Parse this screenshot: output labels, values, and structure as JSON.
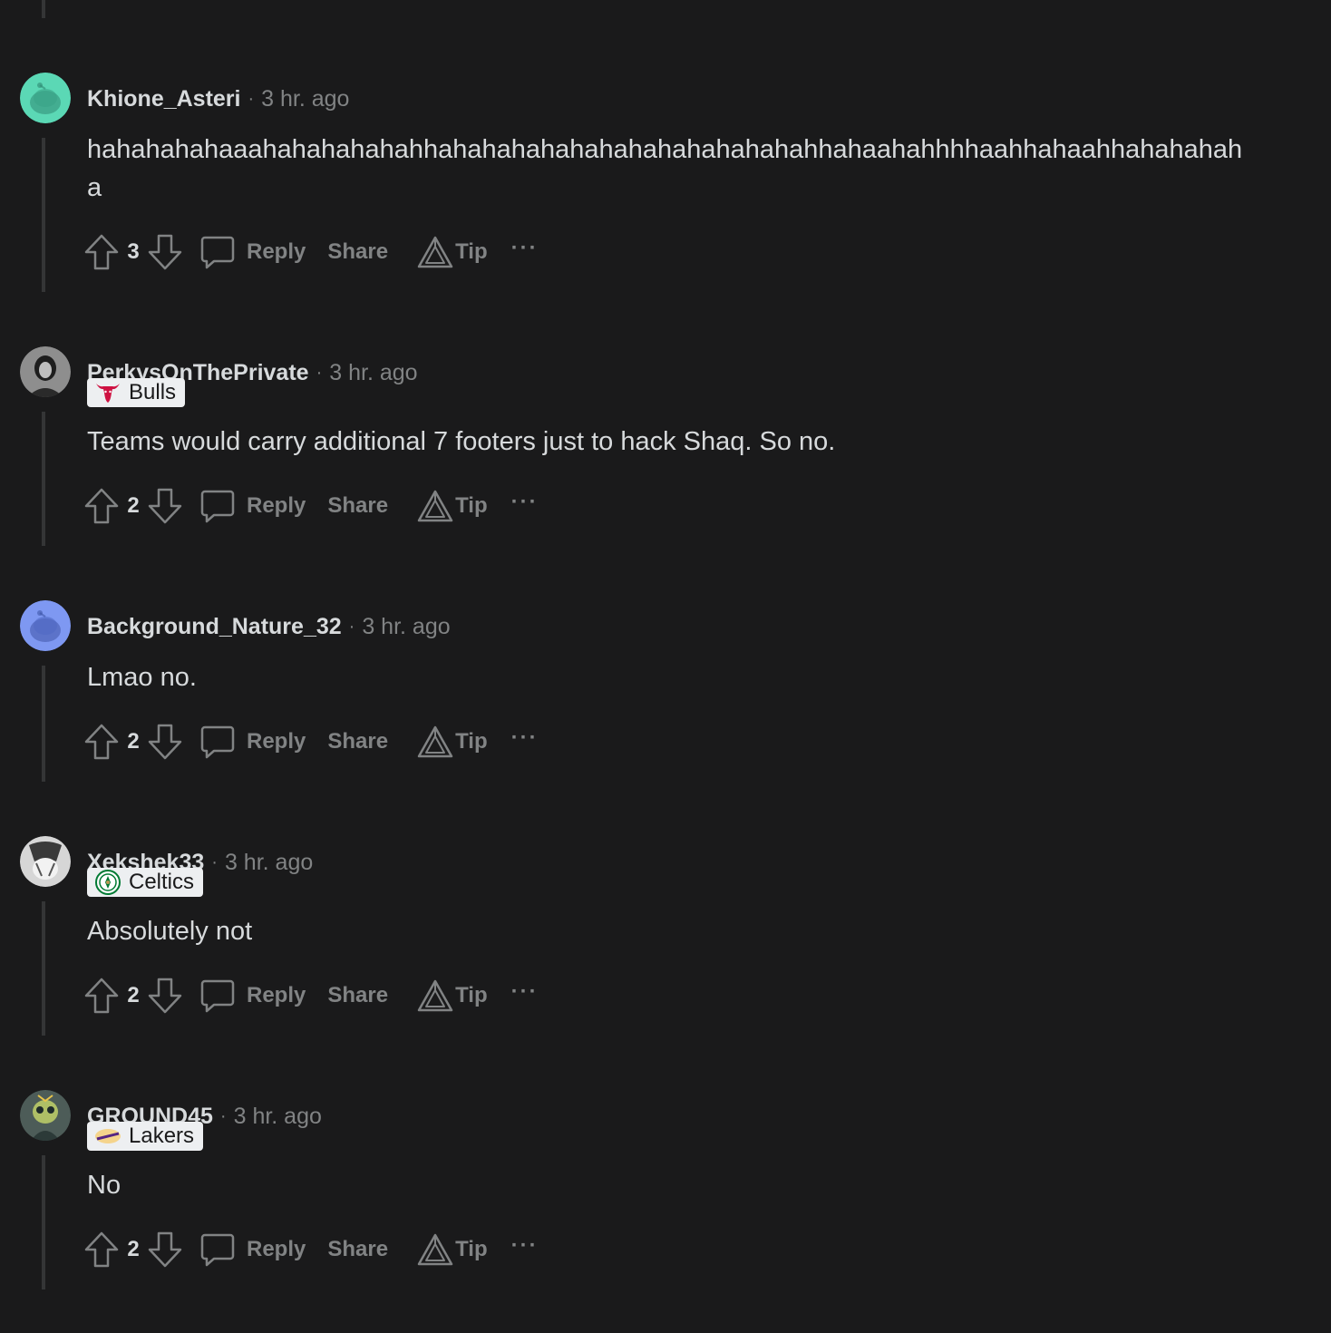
{
  "labels": {
    "reply": "Reply",
    "share": "Share",
    "tip": "Tip",
    "more": "···",
    "separator": "·"
  },
  "comments": [
    {
      "username": "Khione_Asteri",
      "time": "3 hr. ago",
      "flair": null,
      "body": "hahahahahaaahahahahahahhahahahahahahahahahahahahahhahaahahhhhaahhahaahhahahahah a",
      "score": "3",
      "avatar": {
        "type": "snoo",
        "color": "#5bd8b5"
      }
    },
    {
      "username": "PerkysOnThePrivate",
      "time": "3 hr. ago",
      "flair": {
        "label": "Bulls",
        "icon": "bulls-logo-icon"
      },
      "body": "Teams would carry additional 7 footers just to hack Shaq. So no.",
      "score": "2",
      "avatar": {
        "type": "photo",
        "color": "#9a9a9a"
      }
    },
    {
      "username": "Background_Nature_32",
      "time": "3 hr. ago",
      "flair": null,
      "body": "Lmao no.",
      "score": "2",
      "avatar": {
        "type": "snoo",
        "color": "#7e98f2"
      }
    },
    {
      "username": "Xekshek33",
      "time": "3 hr. ago",
      "flair": {
        "label": "Celtics",
        "icon": "celtics-logo-icon"
      },
      "body": "Absolutely not",
      "score": "2",
      "avatar": {
        "type": "photo",
        "color": "#cfcfcf"
      }
    },
    {
      "username": "GROUND45",
      "time": "3 hr. ago",
      "flair": {
        "label": "Lakers",
        "icon": "lakers-logo-icon"
      },
      "body": "No",
      "score": "2",
      "avatar": {
        "type": "photo",
        "color": "#5a6a66"
      }
    }
  ]
}
